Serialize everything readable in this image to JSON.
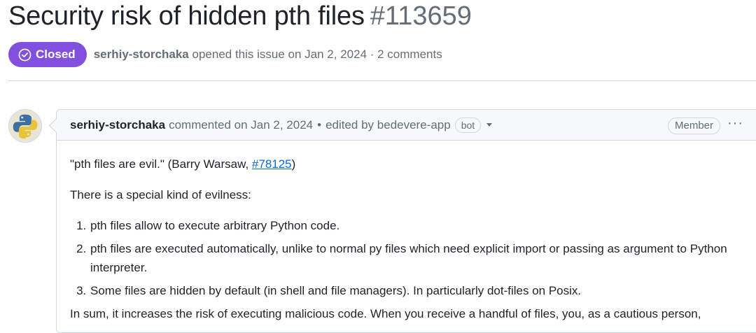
{
  "issue": {
    "title": "Security risk of hidden pth files",
    "number": "#113659",
    "state": "Closed",
    "author": "serhiy-storchaka",
    "opened_text": "opened this issue on Jan 2, 2024 · 2 comments"
  },
  "comment": {
    "author": "serhiy-storchaka",
    "commented_text": "commented on Jan 2, 2024",
    "separator": "•",
    "edited_text": "edited by bedevere-app",
    "bot_label": "bot",
    "member_label": "Member",
    "more_label": "···",
    "quote_prefix": "\"pth files are evil.\" (Barry Warsaw, ",
    "quote_link": "#78125",
    "quote_suffix": ")",
    "intro": "There is a special kind of evilness:",
    "list": [
      "pth files allow to execute arbitrary Python code.",
      "pth files are executed automatically, unlike to normal py files which need explicit import or passing as argument to Python interpreter.",
      "Some files are hidden by default (in shell and file managers). In particularly dot-files on Posix."
    ],
    "summary": "In sum, it increases the risk of executing malicious code. When you receive a handful of files, you, as a cautious person,"
  },
  "colors": {
    "closed_badge": "#8250df",
    "link": "#0969da",
    "muted": "#656d76",
    "border": "#d0d7de"
  },
  "icons": {
    "state_icon": "check-circle-icon",
    "avatar": "python-logo-avatar",
    "caret": "caret-down-icon",
    "more": "kebab-horizontal-icon"
  }
}
